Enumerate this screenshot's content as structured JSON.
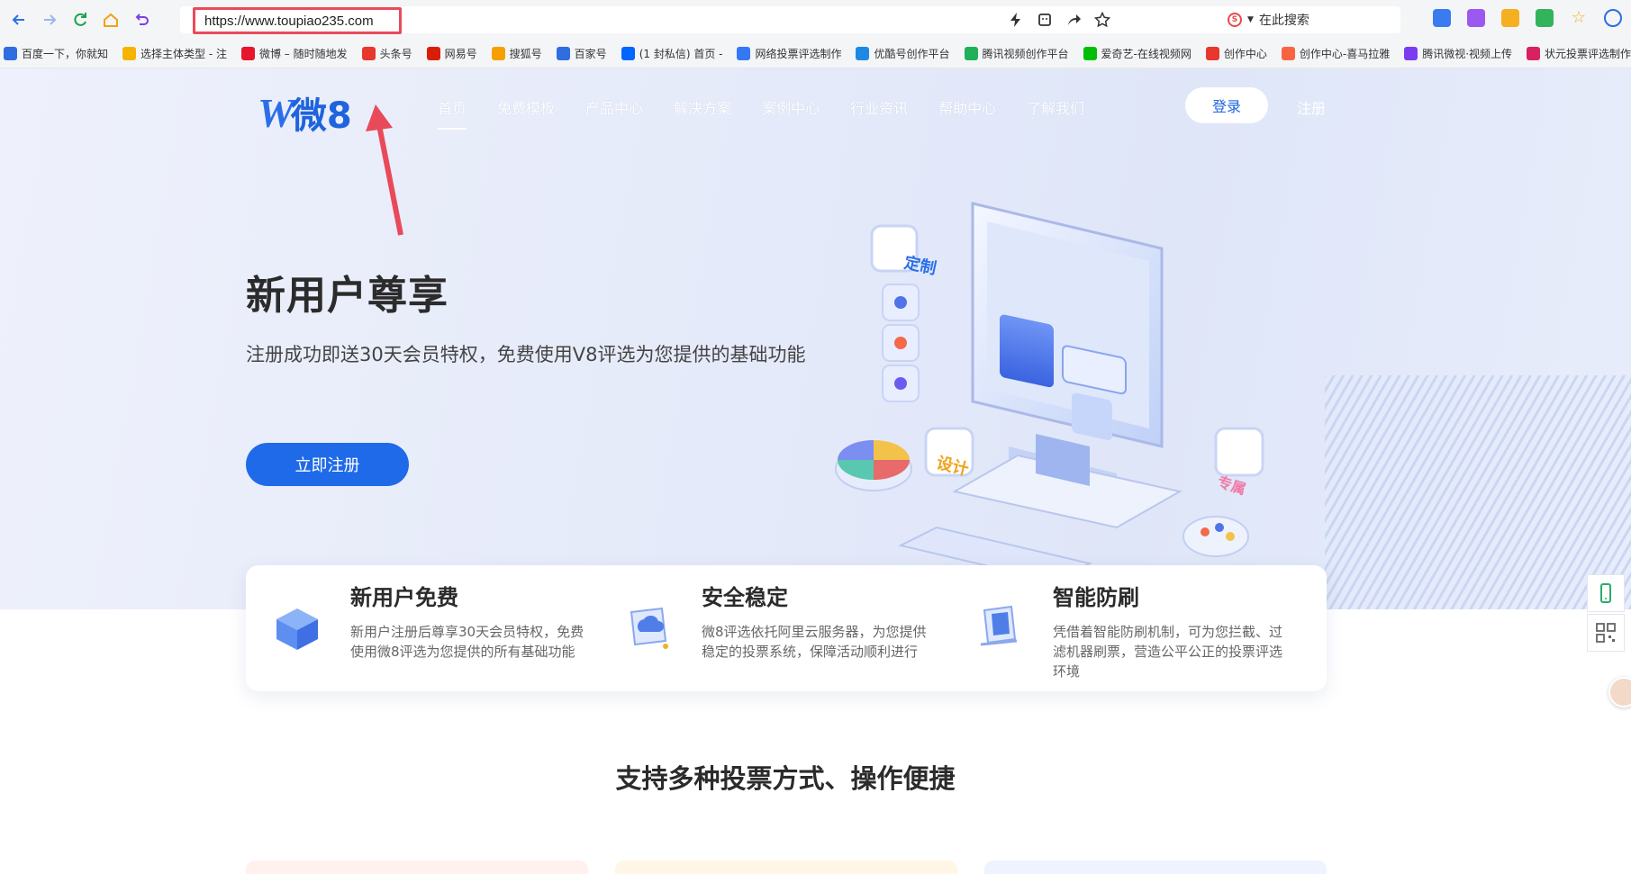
{
  "browser": {
    "url": "https://www.toupiao235.com",
    "search_label": "在此搜索",
    "search_engine_badge": "S"
  },
  "bookmarks": [
    {
      "label": "百度一下，你就知",
      "color": "#2f6de1"
    },
    {
      "label": "选择主体类型 - 注",
      "color": "#f5b400"
    },
    {
      "label": "微博 – 随时随地发",
      "color": "#e6162d"
    },
    {
      "label": "头条号",
      "color": "#e8372c"
    },
    {
      "label": "网易号",
      "color": "#d81e06"
    },
    {
      "label": "搜狐号",
      "color": "#f5a000"
    },
    {
      "label": "百家号",
      "color": "#2f6de1"
    },
    {
      "label": "(1 封私信) 首页 -",
      "color": "#0066ff"
    },
    {
      "label": "网络投票评选制作",
      "color": "#3478f6"
    },
    {
      "label": "优酷号创作平台",
      "color": "#1e88e5"
    },
    {
      "label": "腾讯视频创作平台",
      "color": "#20b05a"
    },
    {
      "label": "爱奇艺-在线视频网",
      "color": "#00be06"
    },
    {
      "label": "创作中心",
      "color": "#e8372c"
    },
    {
      "label": "创作中心-喜马拉雅",
      "color": "#f86442"
    },
    {
      "label": "腾讯微视·视频上传",
      "color": "#7a3cf0"
    },
    {
      "label": "状元投票评选制作",
      "color": "#d8215f"
    }
  ],
  "site": {
    "logo_text": "微8",
    "logo_mark": "W",
    "nav": [
      "首页",
      "免费模板",
      "产品中心",
      "解决方案",
      "案例中心",
      "行业资讯",
      "帮助中心",
      "了解我们"
    ],
    "login": "登录",
    "register": "注册"
  },
  "hero": {
    "title": "新用户尊享",
    "subtitle": "注册成功即送30天会员特权，免费使用V8评选为您提供的基础功能",
    "cta": "立即注册",
    "badges": [
      "定制",
      "设计",
      "专属"
    ]
  },
  "features": [
    {
      "title": "新用户免费",
      "desc": "新用户注册后尊享30天会员特权，免费使用微8评选为您提供的所有基础功能"
    },
    {
      "title": "安全稳定",
      "desc": "微8评选依托阿里云服务器，为您提供稳定的投票系统，保障活动顺利进行"
    },
    {
      "title": "智能防刷",
      "desc": "凭借着智能防刷机制，可为您拦截、过滤机器刷票，营造公平公正的投票评选环境"
    }
  ],
  "section_title": "支持多种投票方式、操作便捷",
  "colors": {
    "accent": "#1f6ae8",
    "annotation": "#e94a5a"
  }
}
